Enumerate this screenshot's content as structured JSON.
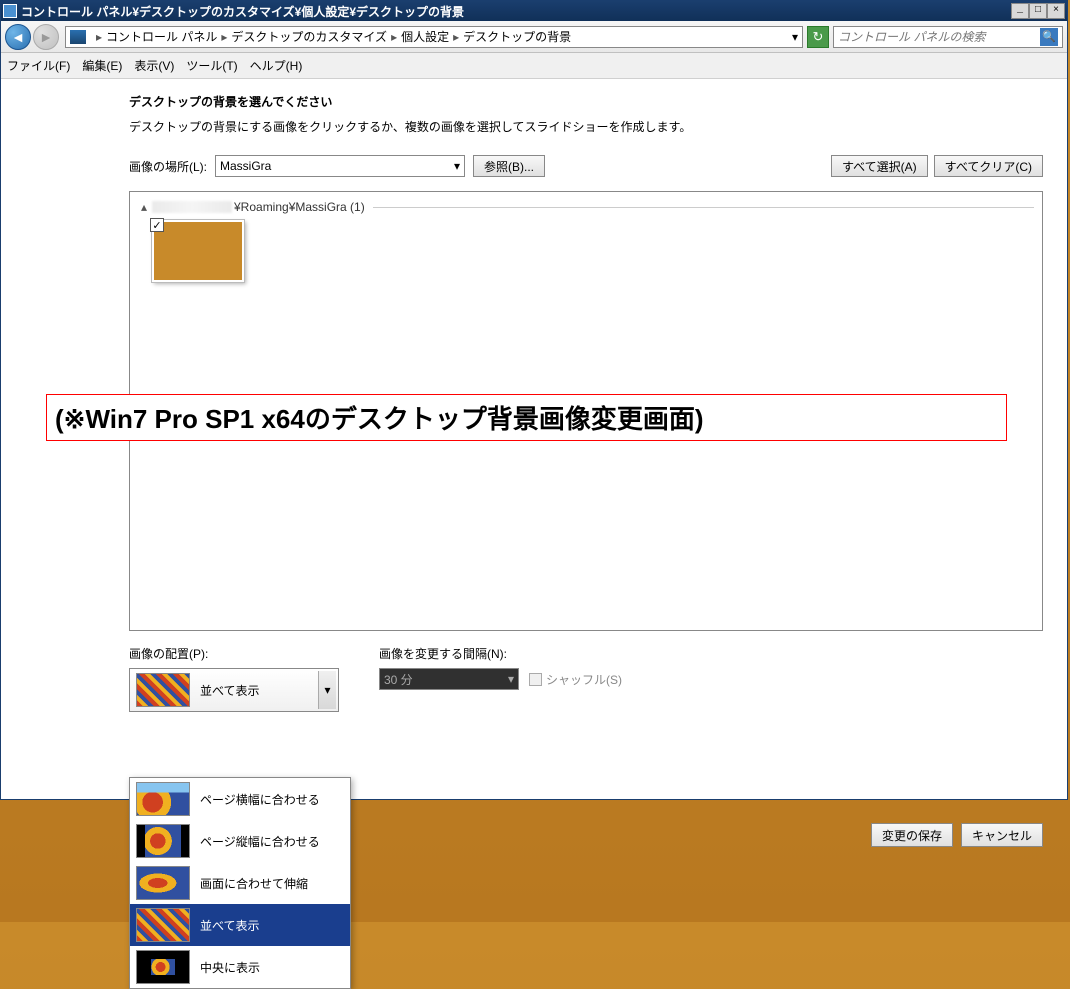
{
  "titlebar": {
    "text": "コントロール パネル¥デスクトップのカスタマイズ¥個人設定¥デスクトップの背景"
  },
  "breadcrumb": {
    "items": [
      "コントロール パネル",
      "デスクトップのカスタマイズ",
      "個人設定",
      "デスクトップの背景"
    ]
  },
  "search": {
    "placeholder": "コントロール パネルの検索"
  },
  "menu": {
    "file": "ファイル(F)",
    "edit": "編集(E)",
    "view": "表示(V)",
    "tools": "ツール(T)",
    "help": "ヘルプ(H)"
  },
  "main": {
    "heading": "デスクトップの背景を選んでください",
    "subheading": "デスクトップの背景にする画像をクリックするか、複数の画像を選択してスライドショーを作成します。",
    "location_label": "画像の場所(L):",
    "location_value": "MassiGra",
    "browse": "参照(B)...",
    "select_all": "すべて選択(A)",
    "clear_all": "すべてクリア(C)",
    "group_path": "¥Roaming¥MassiGra (1)"
  },
  "annotation": "(※Win7 Pro SP1 x64のデスクトップ背景画像変更画面)",
  "placement": {
    "label": "画像の配置(P):",
    "selected": "並べて表示",
    "options": {
      "fit_width": "ページ横幅に合わせる",
      "fit_height": "ページ縦幅に合わせる",
      "stretch": "画面に合わせて伸縮",
      "tile": "並べて表示",
      "center": "中央に表示"
    }
  },
  "interval": {
    "label": "画像を変更する間隔(N):",
    "value": "30 分",
    "shuffle": "シャッフル(S)"
  },
  "footer": {
    "save": "変更の保存",
    "cancel": "キャンセル"
  }
}
